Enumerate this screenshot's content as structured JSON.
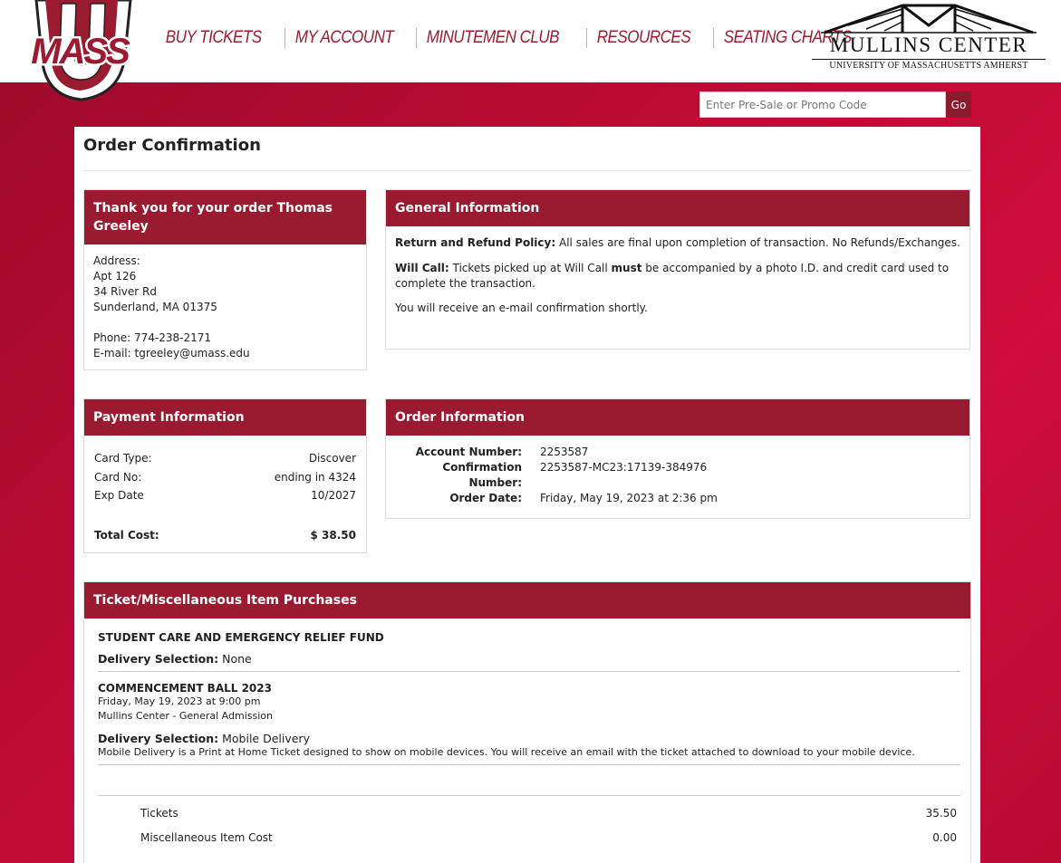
{
  "header": {
    "logo_text": "MASS",
    "nav": [
      "BUY TICKETS",
      "MY ACCOUNT",
      "MINUTEMEN CLUB",
      "RESOURCES",
      "SEATING CHARTS"
    ],
    "venue_name": "MULLINS CENTER",
    "venue_subtitle": "UNIVERSITY OF MASSACHUSETTS AMHERST"
  },
  "promo": {
    "placeholder": "Enter Pre-Sale or Promo Code",
    "button_label": "Go"
  },
  "page_title": "Order Confirmation",
  "thank_you": {
    "heading": "Thank you for your order Thomas Greeley",
    "address_label": "Address:",
    "address_lines": [
      "Apt 126",
      "34 River Rd",
      "Sunderland, MA 01375"
    ],
    "phone_label": "Phone:",
    "phone": "774-238-2171",
    "email_label": "E-mail:",
    "email": "tgreeley@umass.edu"
  },
  "general_info": {
    "heading": "General Information",
    "refund_label": "Return and Refund Policy:",
    "refund_text": "All sales are final upon completion of transaction. No Refunds/Exchanges.",
    "willcall_label": "Will Call:",
    "willcall_text_1": "Tickets picked up at Will Call",
    "willcall_must": "must",
    "willcall_text_2": "be accompanied by a photo I.D. and credit card used to complete the transaction.",
    "email_note": "You will receive an e-mail confirmation shortly."
  },
  "payment": {
    "heading": "Payment Information",
    "rows": [
      {
        "label": "Card Type:",
        "value": "Discover"
      },
      {
        "label": "Card No:",
        "value": "ending in 4324"
      },
      {
        "label": "Exp Date",
        "value": "10/2027"
      }
    ],
    "total_label": "Total Cost:",
    "total_value": "$ 38.50"
  },
  "order": {
    "heading": "Order Information",
    "rows": [
      {
        "label": "Account Number:",
        "value": "2253587"
      },
      {
        "label": "Confirmation Number:",
        "value": "2253587-MC23:17139-384976"
      },
      {
        "label": "Order Date:",
        "value": "Friday, May 19, 2023 at 2:36 pm"
      }
    ]
  },
  "purchases": {
    "heading": "Ticket/Miscellaneous Item Purchases",
    "delivery_label": "Delivery Selection:",
    "items": [
      {
        "title": "STUDENT CARE AND EMERGENCY RELIEF FUND",
        "delivery": "None"
      },
      {
        "title": "COMMENCEMENT BALL 2023",
        "date": "Friday, May 19, 2023 at 9:00 pm",
        "venue": "Mullins Center - General Admission",
        "delivery": "Mobile Delivery",
        "delivery_note": "Mobile Delivery is a Print at Home Ticket designed to show on mobile devices. You will receive an email with the ticket attached to download to your mobile device."
      }
    ],
    "summary": [
      {
        "label": "Tickets",
        "value": "35.50"
      },
      {
        "label": "Miscellaneous Item Cost",
        "value": "0.00"
      }
    ]
  },
  "colors": {
    "brand": "#9a1b30",
    "background": "#c20b37",
    "nav_text": "#9b1b30"
  }
}
